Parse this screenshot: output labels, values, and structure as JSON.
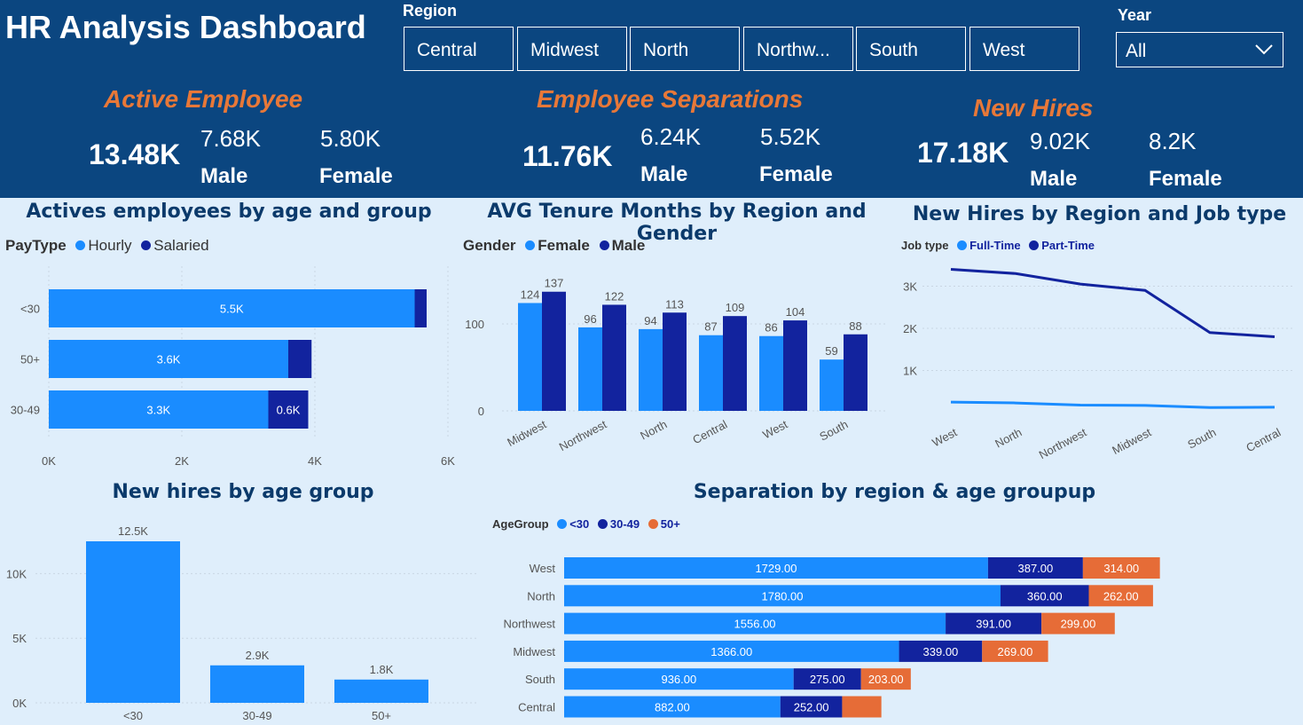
{
  "title": "HR Analysis Dashboard",
  "slicers": {
    "region_label": "Region",
    "regions": [
      "Central",
      "Midwest",
      "North",
      "Northw...",
      "South",
      "West"
    ],
    "year_label": "Year",
    "year_value": "All",
    "chevron": "chevron-down-icon"
  },
  "kpis": [
    {
      "title": "Active Employee",
      "total": "13.48K",
      "male": "7.68K",
      "female": "5.80K",
      "male_label": "Male",
      "female_label": "Female"
    },
    {
      "title": "Employee Separations",
      "total": "11.76K",
      "male": "6.24K",
      "female": "5.52K",
      "male_label": "Male",
      "female_label": "Female"
    },
    {
      "title": "New Hires",
      "total": "17.18K",
      "male": "9.02K",
      "female": "8.2K",
      "male_label": "Male",
      "female_label": "Female"
    }
  ],
  "colors": {
    "light": "#1a8cff",
    "dark": "#12239e",
    "orange": "#e66c37",
    "header": "#0b4680"
  },
  "chart_data": [
    {
      "type": "bar",
      "orientation": "horizontal",
      "stacked": true,
      "title": "Actives employees by age and group",
      "legend_title": "PayType",
      "categories": [
        "<30",
        "50+",
        "30-49"
      ],
      "series": [
        {
          "name": "Hourly",
          "values": [
            5500,
            3600,
            3300
          ],
          "labels": [
            "5.5K",
            "3.6K",
            "3.3K"
          ]
        },
        {
          "name": "Salaried",
          "values": [
            180,
            350,
            600
          ],
          "labels": [
            "",
            "",
            "0.6K"
          ]
        }
      ],
      "xlim": [
        0,
        6000
      ],
      "xticks": [
        "0K",
        "2K",
        "4K",
        "6K"
      ]
    },
    {
      "type": "bar",
      "orientation": "vertical",
      "grouped": true,
      "title": "AVG Tenure Months by Region and Gender",
      "legend_title": "Gender",
      "categories": [
        "Midwest",
        "Northwest",
        "North",
        "Central",
        "West",
        "South"
      ],
      "series": [
        {
          "name": "Female",
          "values": [
            124,
            96,
            94,
            87,
            86,
            59
          ]
        },
        {
          "name": "Male",
          "values": [
            137,
            122,
            113,
            109,
            104,
            88
          ]
        }
      ],
      "ylim": [
        0,
        150
      ],
      "yticks": [
        "0",
        "100"
      ]
    },
    {
      "type": "line",
      "title": "New Hires by Region and Job type",
      "legend_title": "Job type",
      "categories": [
        "West",
        "North",
        "Northwest",
        "Midwest",
        "South",
        "Central"
      ],
      "series": [
        {
          "name": "Full-Time",
          "values": [
            3400,
            3300,
            3050,
            2900,
            1900,
            1800
          ]
        },
        {
          "name": "Part-Time",
          "values": [
            250,
            230,
            180,
            170,
            120,
            130
          ]
        }
      ],
      "ylim": [
        0,
        3600
      ],
      "yticks": [
        "1K",
        "2K",
        "3K"
      ]
    },
    {
      "type": "bar",
      "orientation": "vertical",
      "title": "New hires by age group",
      "categories": [
        "<30",
        "30-49",
        "50+"
      ],
      "values": [
        12500,
        2900,
        1800
      ],
      "labels": [
        "12.5K",
        "2.9K",
        "1.8K"
      ],
      "ylim": [
        0,
        12500
      ],
      "yticks": [
        "0K",
        "5K",
        "10K"
      ]
    },
    {
      "type": "bar",
      "orientation": "horizontal",
      "stacked": true,
      "title": "Separation by region & age groupup",
      "legend_title": "AgeGroup",
      "categories": [
        "West",
        "North",
        "Northwest",
        "Midwest",
        "South",
        "Central"
      ],
      "series": [
        {
          "name": "<30",
          "values": [
            1729,
            1780,
            1556,
            1366,
            936,
            882
          ],
          "labels": [
            "1729.00",
            "1780.00",
            "1556.00",
            "1366.00",
            "936.00",
            "882.00"
          ]
        },
        {
          "name": "30-49",
          "values": [
            387,
            360,
            391,
            339,
            275,
            252
          ],
          "labels": [
            "387.00",
            "360.00",
            "391.00",
            "339.00",
            "275.00",
            "252.00"
          ]
        },
        {
          "name": "50+",
          "values": [
            314,
            262,
            299,
            269,
            203,
            160
          ],
          "labels": [
            "314.00",
            "262.00",
            "299.00",
            "269.00",
            "203.00",
            ""
          ]
        }
      ],
      "xlim": [
        0,
        2430
      ]
    }
  ]
}
